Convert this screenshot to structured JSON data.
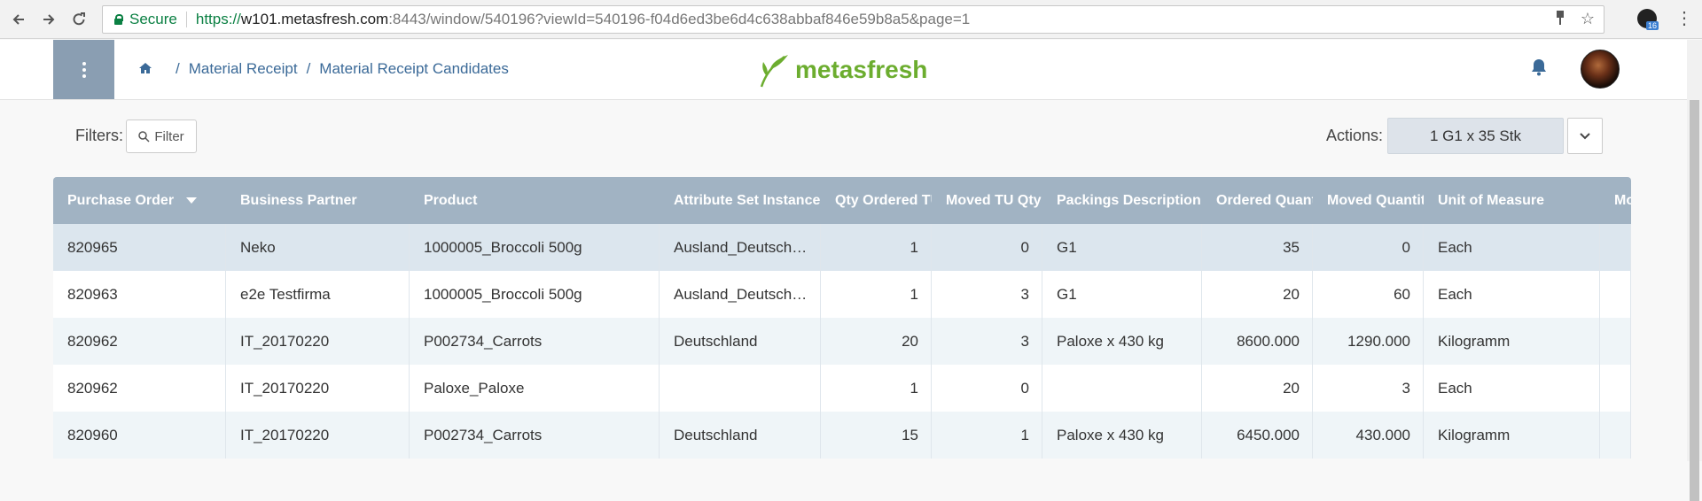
{
  "browser": {
    "secure_label": "Secure",
    "url_proto": "https://",
    "url_host": "w101.metasfresh.com",
    "url_rest": ":8443/window/540196?viewId=540196-f04d6ed3be6d4c638abbaf846e59b8a5&page=1",
    "extension_badge": "16"
  },
  "header": {
    "breadcrumb": [
      "Material Receipt",
      "Material Receipt Candidates"
    ],
    "logo_text": "metasfresh"
  },
  "toolbar": {
    "filters_label": "Filters:",
    "filter_button": "Filter",
    "actions_label": "Actions:",
    "action_button": "1 G1 x 35 Stk"
  },
  "table": {
    "columns": [
      "Purchase Order",
      "Business Partner",
      "Product",
      "Attribute Set Instance",
      "Qty Ordered TU",
      "Moved TU Qty",
      "Packings Description",
      "Ordered Quantity",
      "Moved Quantity",
      "Unit of Measure",
      "Mo"
    ],
    "sorted_column": "Purchase Order",
    "rows": [
      [
        "820965",
        "Neko",
        "1000005_Broccoli 500g",
        "Ausland_Deutsch…",
        "1",
        "0",
        "G1",
        "35",
        "0",
        "Each",
        ""
      ],
      [
        "820963",
        "e2e Testfirma",
        "1000005_Broccoli 500g",
        "Ausland_Deutsch…",
        "1",
        "3",
        "G1",
        "20",
        "60",
        "Each",
        ""
      ],
      [
        "820962",
        "IT_20170220",
        "P002734_Carrots",
        "Deutschland",
        "20",
        "3",
        "Paloxe x 430 kg",
        "8600.000",
        "1290.000",
        "Kilogramm",
        ""
      ],
      [
        "820962",
        "IT_20170220",
        "Paloxe_Paloxe",
        "",
        "1",
        "0",
        "",
        "20",
        "3",
        "Each",
        ""
      ],
      [
        "820960",
        "IT_20170220",
        "P002734_Carrots",
        "Deutschland",
        "15",
        "1",
        "Paloxe x 430 kg",
        "6450.000",
        "430.000",
        "Kilogramm",
        ""
      ]
    ],
    "selected_row": 0
  }
}
